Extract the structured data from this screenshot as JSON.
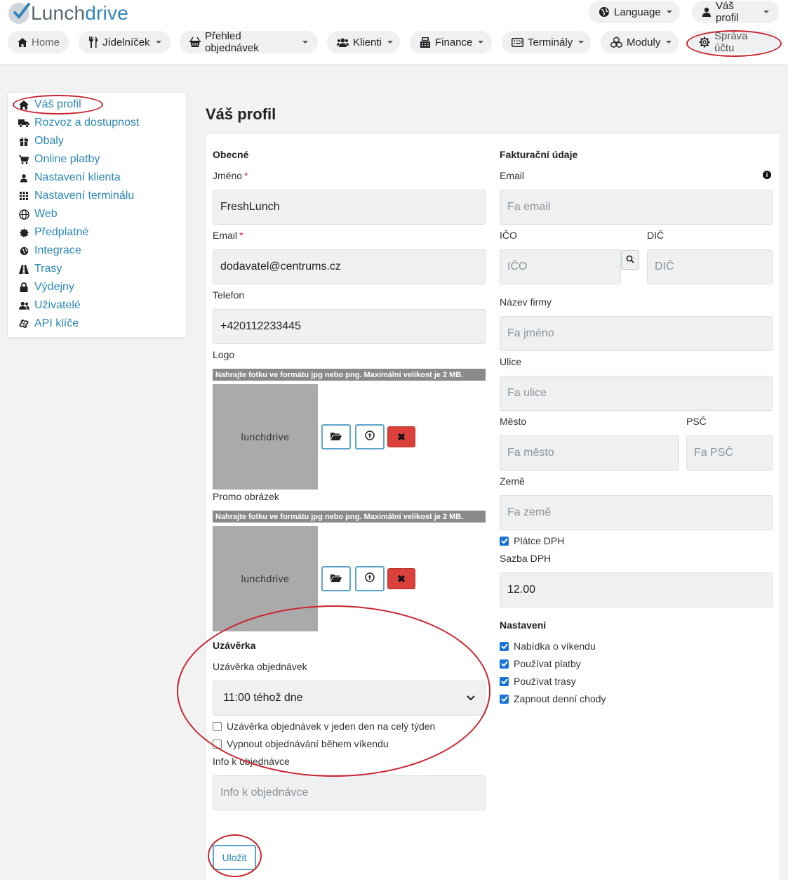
{
  "brand": {
    "part1": "Lunch",
    "part2": "drive"
  },
  "header": {
    "language_label": "Language",
    "profile_label": "Váš profil"
  },
  "nav": {
    "home": "Home",
    "menu": "Jídelníček",
    "orders": "Přehled objednávek",
    "clients": "Klienti",
    "finance": "Finance",
    "terminals": "Terminály",
    "modules": "Moduly",
    "account": "Správa účtu"
  },
  "sidebar": {
    "items": [
      {
        "label": "Váš profil",
        "icon": "home-icon"
      },
      {
        "label": "Rozvoz a dostupnost",
        "icon": "truck-icon"
      },
      {
        "label": "Obaly",
        "icon": "gift-icon"
      },
      {
        "label": "Online platby",
        "icon": "cart-icon"
      },
      {
        "label": "Nastavení klienta",
        "icon": "user-icon"
      },
      {
        "label": "Nastavení terminálu",
        "icon": "grid-icon"
      },
      {
        "label": "Web",
        "icon": "globe-icon"
      },
      {
        "label": "Předplatné",
        "icon": "badge-icon"
      },
      {
        "label": "Integrace",
        "icon": "globe-small-icon"
      },
      {
        "label": "Trasy",
        "icon": "road-icon"
      },
      {
        "label": "Výdejny",
        "icon": "lock-icon"
      },
      {
        "label": "Uživatelé",
        "icon": "users-icon"
      },
      {
        "label": "API klíče",
        "icon": "link-icon"
      }
    ]
  },
  "page": {
    "title": "Váš profil"
  },
  "general": {
    "section_title": "Obecné",
    "name_label": "Jméno",
    "name_value": "FreshLunch",
    "email_label": "Email",
    "email_value": "dodavatel@centrums.cz",
    "phone_label": "Telefon",
    "phone_value": "+420112233445",
    "required_mark": "*",
    "logo_label": "Logo",
    "upload_hint": "Nahrajte fotku ve formátu jpg nebo png. Maximální velikost je 2 MB.",
    "placeholder_image_text": "lunchdrive",
    "promo_label": "Promo obrázek"
  },
  "cutoff": {
    "section_title": "Uzávěrka",
    "select_label": "Uzávěrka objednávek",
    "select_value": "11:00 téhož dne",
    "check_one_day": "Uzávěrka objednávek v jeden den na celý týden",
    "check_one_day_checked": false,
    "check_weekend": "Vypnout objednávání během víkendu",
    "check_weekend_checked": false,
    "info_label": "Info k objednávce",
    "info_placeholder": "Info k objednávce"
  },
  "billing": {
    "section_title": "Fakturační údaje",
    "email_label": "Email",
    "email_placeholder": "Fa email",
    "ico_label": "IČO",
    "ico_placeholder": "IČO",
    "dic_label": "DIČ",
    "dic_placeholder": "DIČ",
    "company_label": "Název firmy",
    "company_placeholder": "Fa jméno",
    "street_label": "Ulice",
    "street_placeholder": "Fa ulice",
    "city_label": "Město",
    "city_placeholder": "Fa město",
    "zip_label": "PSČ",
    "zip_placeholder": "Fa PSČ",
    "country_label": "Země",
    "country_placeholder": "Fa země",
    "vat_payer_label": "Plátce DPH",
    "vat_payer_checked": true,
    "vat_rate_label": "Sazba DPH",
    "vat_rate_value": "12.00"
  },
  "settings": {
    "section_title": "Nastavení",
    "options": [
      {
        "label": "Nabídka o víkendu",
        "checked": true
      },
      {
        "label": "Používat platby",
        "checked": true
      },
      {
        "label": "Používat trasy",
        "checked": true
      },
      {
        "label": "Zapnout denní chody",
        "checked": true
      }
    ]
  },
  "actions": {
    "save_label": "Uložit"
  },
  "colors": {
    "accent": "#2b88b7",
    "annotation": "#c8242e",
    "delete": "#d9413a"
  }
}
